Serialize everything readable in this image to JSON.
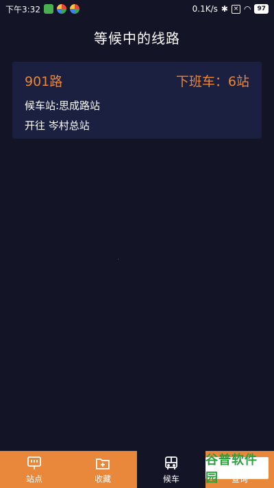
{
  "status_bar": {
    "time": "下午3:32",
    "network_speed": "0.1K/s",
    "battery": "97",
    "bluetooth_icon": "bluetooth-icon",
    "wifi_icon": "wifi-icon"
  },
  "header": {
    "title": "等候中的线路"
  },
  "route_card": {
    "route_name": "901路",
    "next_bus": "下班车：6站",
    "waiting_station": "候车站:思成路站",
    "direction": "开往 岑村总站"
  },
  "bottom_nav": {
    "items": [
      {
        "label": "站点",
        "icon": "stop-board-icon"
      },
      {
        "label": "收藏",
        "icon": "folder-plus-icon"
      },
      {
        "label": "候车",
        "icon": "bus-icon"
      },
      {
        "label": "查询",
        "icon": "search-icon"
      }
    ]
  },
  "watermark": "谷普软件园",
  "colors": {
    "background": "#131426",
    "accent": "#e9873a",
    "card": "#1b2040"
  }
}
